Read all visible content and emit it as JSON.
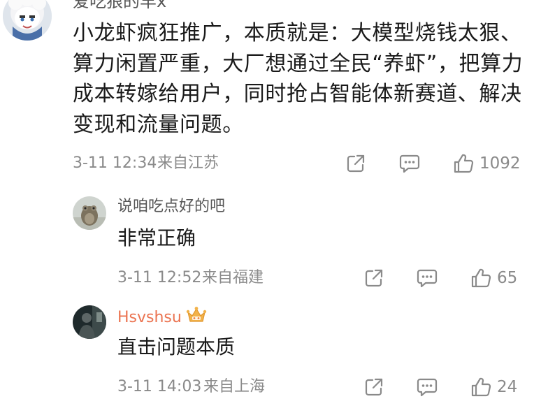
{
  "main_comment": {
    "username": "爱吃狼的羊x",
    "text": "小龙虾疯狂推广，本质就是：大模型烧钱太狠、算力闲置严重，大厂想通过全民“养虾”，把算力成本转嫁给用户，同时抢占智能体新赛道、解决变现和流量问题。",
    "time": "3-11 12:34",
    "location": "来自江苏",
    "likes": "1092"
  },
  "replies": [
    {
      "username": "说咱吃点好的吧",
      "text": "非常正确",
      "time": "3-11 12:52",
      "location": "来自福建",
      "likes": "65"
    },
    {
      "username": "Hsvshsu",
      "text": "直击问题本质",
      "time": "3-11 14:03",
      "location": "来自上海",
      "likes": "24"
    }
  ],
  "icons": {
    "share": "share-icon",
    "comment": "comment-icon",
    "like": "thumbs-up-icon",
    "vip": "crown-badge-icon"
  },
  "colors": {
    "text_primary": "#1a1a1a",
    "text_secondary": "#8a8a8a",
    "vip_name": "#eb7350",
    "crown": "#f0a93b"
  }
}
